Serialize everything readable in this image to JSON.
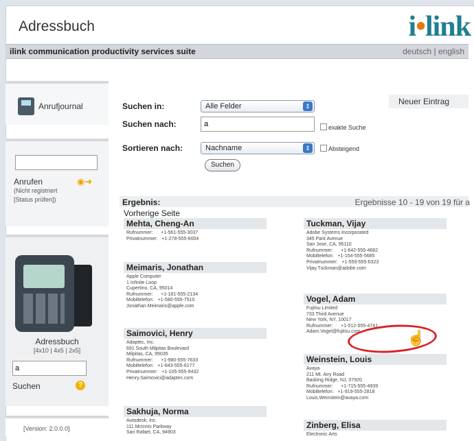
{
  "app": {
    "title": "Adressbuch",
    "logo_prefix": "i",
    "logo_dot": "•",
    "logo_suffix": "link",
    "suite": "ilink communication productivity services suite"
  },
  "lang": {
    "de": "deutsch",
    "sep": "|",
    "en": "english"
  },
  "sidebar": {
    "journal": "Anrufjournal",
    "call_label": "Anrufen",
    "call_note": "(Nicht registriert",
    "call_status": "[Status prüfen])",
    "addr_label": "Adressbuch",
    "addr_views": "[4x10 | 4x5 | 2x5]",
    "addr_query": "a",
    "search_label": "Suchen",
    "help_icon": "?",
    "version": "[Version: 2.0.0.0]"
  },
  "search": {
    "in_label": "Suchen in:",
    "in_value": "Alle Felder",
    "for_label": "Suchen nach:",
    "for_value": "a",
    "exact": "exakte Suche",
    "sort_label": "Sortieren nach:",
    "sort_value": "Nachname",
    "desc": "Absteigend",
    "button": "Suchen",
    "new_entry": "Neuer Eintrag"
  },
  "results": {
    "label": "Ergebnis:",
    "range": "Ergebnisse 10 - 19 von 19 für a",
    "prev": "Vorherige Seite"
  },
  "entries_left": [
    {
      "name": "Mehta, Cheng-An",
      "lines": "Rufnummer:      +1-561-555-3037\nPrivatnummer:   +1-278-555-6004"
    },
    {
      "name": "Meimaris, Jonathan",
      "lines": "Apple Computer\n1 Infinite Loop\nCupertino, CA, 95014\nRufnummer:      +1-181-555-2134\nMobiltelefon:   +1-580-555-7510\nJonathan.Meimaris@apple.com"
    },
    {
      "name": "Saimovici, Henry",
      "lines": "Adaptec, Inc.\n691 South Milpitas Boulevard\nMilpitas, CA, 95035\nRufnummer:      +1-980-555-7633\nMobiltelefon:   +1-843-555-6177\nPrivatnummer:   +1-105-555-9432\nHenry.Saimovici@adaptec.com"
    },
    {
      "name": "Sakhuja, Norma",
      "lines": "Autodesk, Inc.\n111 McInnis Parkway\nSan Rafael, CA, 94903"
    }
  ],
  "entries_right": [
    {
      "name": "Tuckman, Vijay",
      "lines": "Adobe Systems Incorporated\n345 Park Avenue\nSan Jose, CA, 95110\nRufnummer:      +1-642-555-4682\nMobiltelefon:   +1-154-555-5685\nPrivatnummer:   +1-559-555-6323\nVijay.Tuckman@adobe.com"
    },
    {
      "name": "Vogel, Adam",
      "lines": "Fujitsu Limited\n733 Third Avenue\nNew York, NY, 10017\nRufnummer:      +1-512-555-4741\nAdam.Vogel@fujitsu.com"
    },
    {
      "name": "Weinstein, Louis",
      "lines": "Avaya\n211 Mt. Airy Road\nBasking Ridge, NJ, 07920\nRufnummer:      +1-715-555-4939\nMobiltelefon:   +1-919-555-2818\nLouis.Weinstein@avaya.com"
    },
    {
      "name": "Zinberg, Elisa",
      "lines": "Electronic Arts"
    }
  ]
}
